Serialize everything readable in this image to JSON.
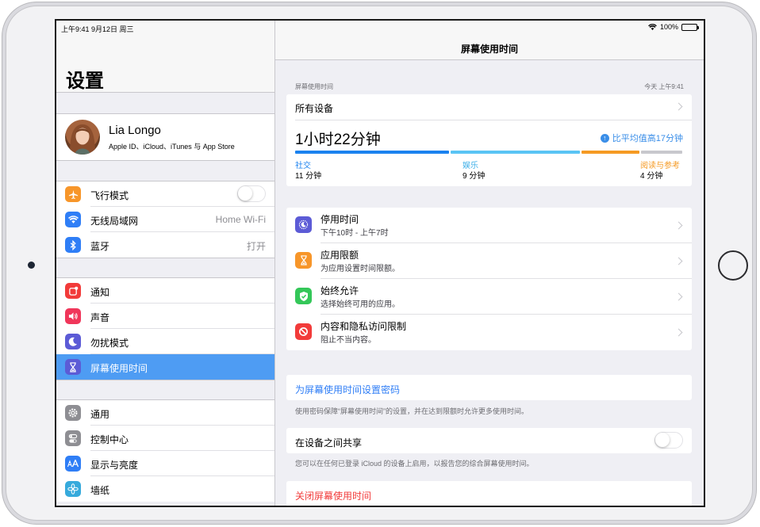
{
  "status_bar": {
    "time_date": "上午9:41  9月12日 周三",
    "battery": "100%"
  },
  "sidebar": {
    "title": "设置",
    "profile": {
      "name": "Lia Longo",
      "subtitle": "Apple ID、iCloud、iTunes 与 App Store"
    },
    "group1": [
      {
        "label": "飞行模式",
        "icon": "airplane-icon",
        "color": "#f7962a",
        "control": "toggle"
      },
      {
        "label": "无线局域网",
        "icon": "wifi-icon",
        "color": "#2f7ef6",
        "value": "Home Wi-Fi"
      },
      {
        "label": "蓝牙",
        "icon": "bluetooth-icon",
        "color": "#2f7ef6",
        "value": "打开"
      }
    ],
    "group2": [
      {
        "label": "通知",
        "icon": "notifications-icon",
        "color": "#f23b3a"
      },
      {
        "label": "声音",
        "icon": "speaker-icon",
        "color": "#f0365a"
      },
      {
        "label": "勿扰模式",
        "icon": "moon-icon",
        "color": "#5c5bd6"
      },
      {
        "label": "屏幕使用时间",
        "icon": "hourglass-icon",
        "color": "#5c5bd6",
        "selected": true
      }
    ],
    "group3": [
      {
        "label": "通用",
        "icon": "gear-icon",
        "color": "#8e8e93"
      },
      {
        "label": "控制中心",
        "icon": "switches-icon",
        "color": "#8e8e93"
      },
      {
        "label": "显示与亮度",
        "icon": "text-size-icon",
        "color": "#2f7ef6"
      },
      {
        "label": "墙纸",
        "icon": "flower-icon",
        "color": "#36aadc"
      }
    ]
  },
  "main": {
    "nav_title": "屏幕使用时间",
    "section_label": "屏幕使用时间",
    "section_time": "今天 上午9:41",
    "devices_label": "所有设备",
    "total": "1小时22分钟",
    "compare": "比平均值高17分钟",
    "categories": [
      {
        "name": "社交",
        "time": "11 分钟",
        "color": "#1b82ef"
      },
      {
        "name": "娱乐",
        "time": "9 分钟",
        "color": "#5ac4f4"
      },
      {
        "name": "阅读与参考",
        "time": "4 分钟",
        "color": "#f59a23"
      },
      {
        "name": "",
        "time": "",
        "color": "#c8c8cd"
      }
    ],
    "options": [
      {
        "title": "停用时间",
        "sub": "下午10时 - 上午7时",
        "icon": "downtime-icon",
        "color": "#5c5bd6"
      },
      {
        "title": "应用限额",
        "sub": "为应用设置时间限额。",
        "icon": "hourglass-icon",
        "color": "#f7962a"
      },
      {
        "title": "始终允许",
        "sub": "选择始终可用的应用。",
        "icon": "checkmark-icon",
        "color": "#34c759"
      },
      {
        "title": "内容和隐私访问限制",
        "sub": "阻止不当内容。",
        "icon": "prohibited-icon",
        "color": "#f23b3a"
      }
    ],
    "passcode_link": "为屏幕使用时间设置密码",
    "passcode_footer": "使用密码保障“屏幕使用时间”的设置，并在达到限额时允许更多使用时间。",
    "share_label": "在设备之间共享",
    "share_footer": "您可以在任何已登录 iCloud 的设备上启用，以报告您的综合屏幕使用时间。",
    "turn_off": "关闭屏幕使用时间",
    "link_color": "#2f7ef6",
    "destructive_color": "#f23b3a"
  }
}
